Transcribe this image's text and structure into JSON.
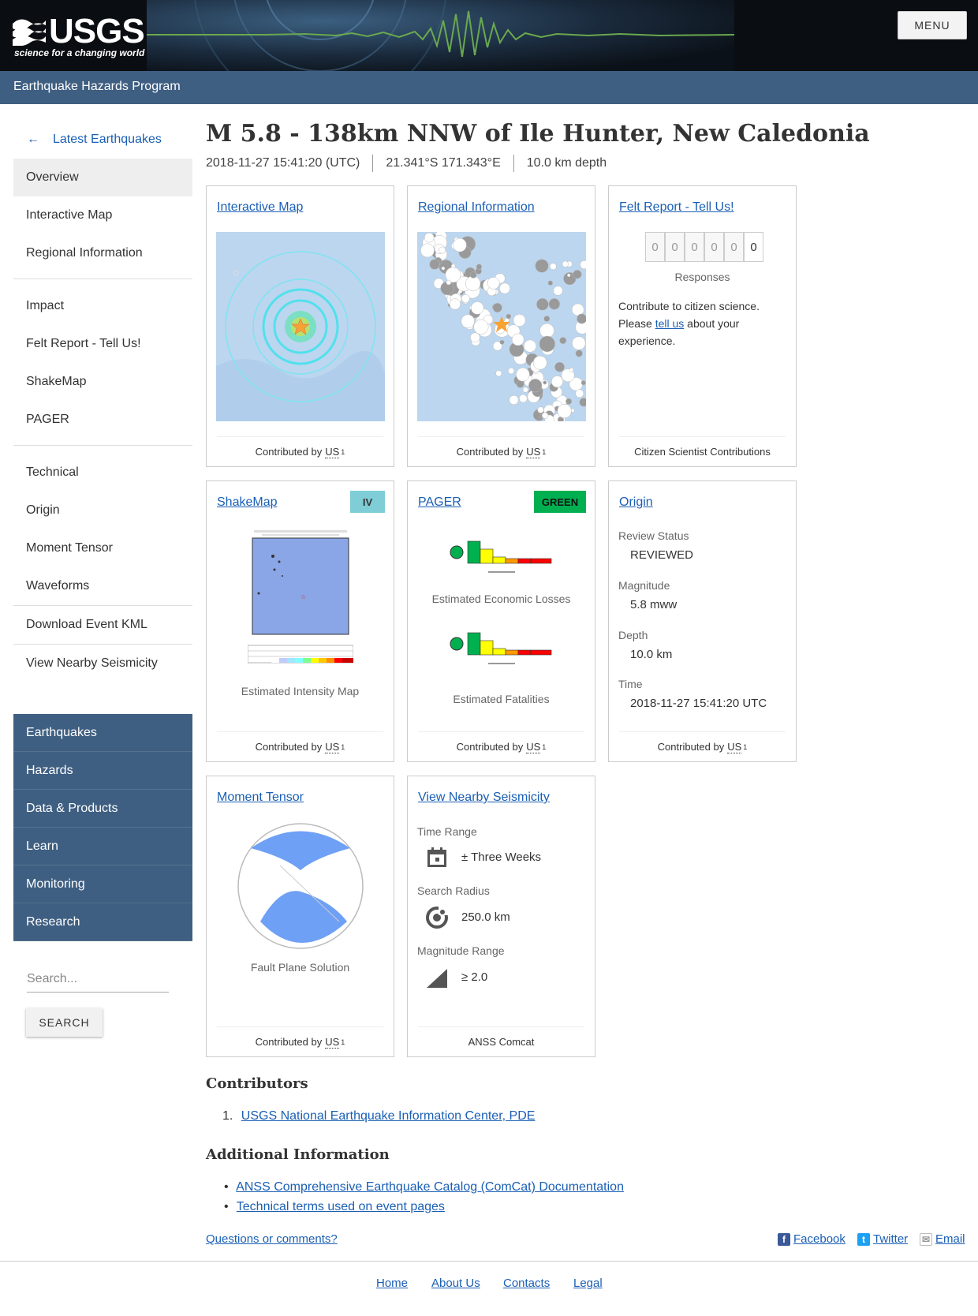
{
  "header": {
    "logo_text": "USGS",
    "logo_tagline": "science for a changing world",
    "menu_label": "MENU",
    "program": "Earthquake Hazards Program"
  },
  "sidebar": {
    "back_label": "Latest Earthquakes",
    "group1": [
      "Overview",
      "Interactive Map",
      "Regional Information"
    ],
    "group2": [
      "Impact",
      "Felt Report - Tell Us!",
      "ShakeMap",
      "PAGER"
    ],
    "group3": [
      "Technical",
      "Origin",
      "Moment Tensor",
      "Waveforms"
    ],
    "group4": [
      "Download Event KML"
    ],
    "group5": [
      "View Nearby Seismicity"
    ],
    "active_index": 0
  },
  "site_nav": [
    "Earthquakes",
    "Hazards",
    "Data & Products",
    "Learn",
    "Monitoring",
    "Research"
  ],
  "search": {
    "placeholder": "Search...",
    "button": "SEARCH"
  },
  "event": {
    "title": "M 5.8 - 138km NNW of Ile Hunter, New Caledonia",
    "time": "2018-11-27 15:41:20 (UTC)",
    "location": "21.341°S 171.343°E",
    "depth": "10.0 km depth"
  },
  "cards": {
    "contributed_prefix": "Contributed by",
    "contributor_code": "US",
    "contributor_ref": "1",
    "interactive_map": {
      "title": "Interactive Map"
    },
    "regional": {
      "title": "Regional Information"
    },
    "felt": {
      "title": "Felt Report - Tell Us!",
      "digits": [
        "0",
        "0",
        "0",
        "0",
        "0",
        "0"
      ],
      "responses_label": "Responses",
      "text_before": "Contribute to citizen science. Please",
      "link": "tell us",
      "text_after": "about your experience.",
      "footer": "Citizen Scientist Contributions"
    },
    "shakemap": {
      "title": "ShakeMap",
      "badge": "IV",
      "badge_color": "#7fcdd6",
      "caption": "Estimated Intensity Map"
    },
    "pager": {
      "title": "PAGER",
      "badge": "GREEN",
      "badge_color": "#00b050",
      "caption_losses": "Estimated Economic Losses",
      "caption_fatalities": "Estimated Fatalities"
    },
    "origin": {
      "title": "Origin",
      "review_label": "Review Status",
      "review_value": "REVIEWED",
      "magnitude_label": "Magnitude",
      "magnitude_value": "5.8 mww",
      "depth_label": "Depth",
      "depth_value": "10.0 km",
      "time_label": "Time",
      "time_value": "2018-11-27 15:41:20 UTC"
    },
    "moment_tensor": {
      "title": "Moment Tensor",
      "caption": "Fault Plane Solution",
      "beachball_color": "#6ea0f5"
    },
    "nearby": {
      "title": "View Nearby Seismicity",
      "time_label": "Time Range",
      "time_value": "± Three Weeks",
      "radius_label": "Search Radius",
      "radius_value": "250.0 km",
      "mag_label": "Magnitude Range",
      "mag_value": "≥ 2.0",
      "footer": "ANSS Comcat"
    }
  },
  "contributors": {
    "heading": "Contributors",
    "items": [
      "USGS National Earthquake Information Center, PDE"
    ]
  },
  "additional": {
    "heading": "Additional Information",
    "items": [
      "ANSS Comprehensive Earthquake Catalog (ComCat) Documentation",
      "Technical terms used on event pages"
    ]
  },
  "questions": "Questions or comments?",
  "share": [
    "Facebook",
    "Twitter",
    "Email"
  ],
  "footer_links": [
    "Home",
    "About Us",
    "Contacts",
    "Legal"
  ]
}
